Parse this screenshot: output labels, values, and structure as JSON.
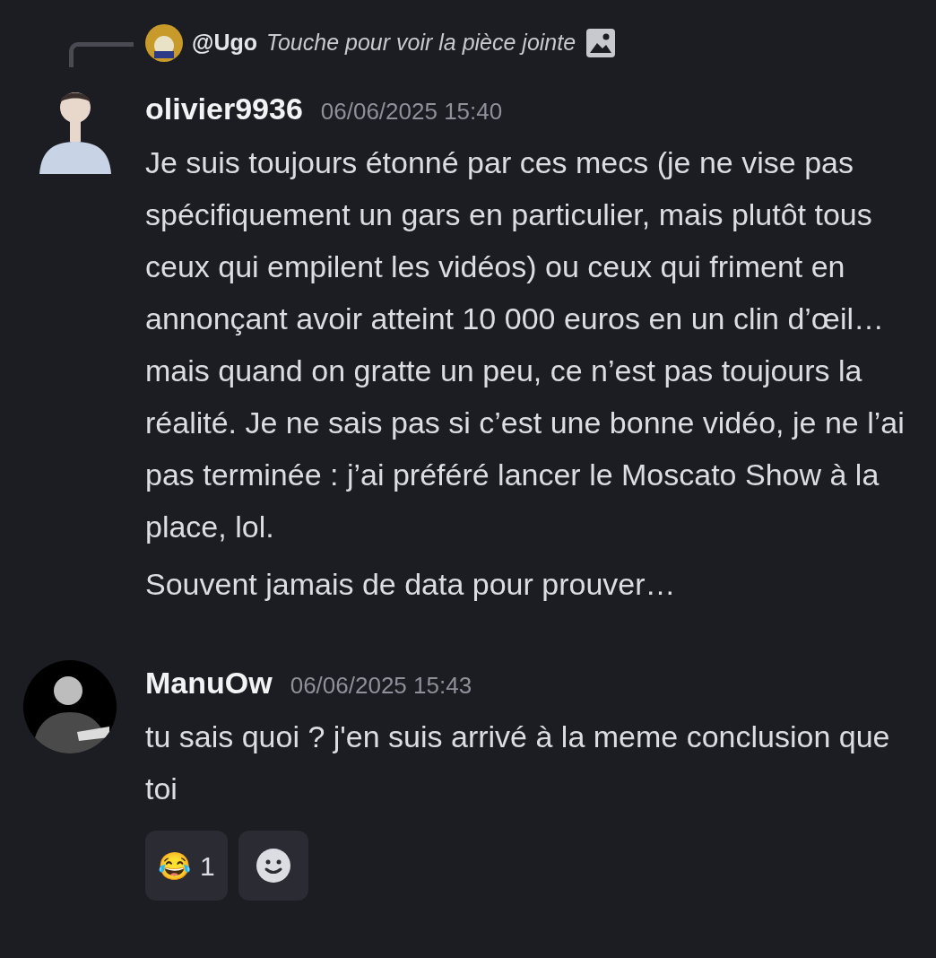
{
  "reply": {
    "author": "@Ugo",
    "preview": "Touche pour voir la pièce jointe"
  },
  "messages": [
    {
      "author": "olivier9936",
      "time": "06/06/2025 15:40",
      "paragraphs": [
        "Je suis toujours étonné par ces mecs (je ne vise pas spécifiquement un gars en particulier, mais plutôt tous ceux qui empilent les vidéos) ou ceux qui friment en annonçant avoir atteint 10 000 euros  en un clin d’œil… mais quand on gratte un peu, ce n’est pas toujours la réalité. Je ne sais pas si c’est une bonne vidéo, je ne l’ai pas terminée : j’ai préféré lancer le Moscato Show à la place, lol.",
        "Souvent jamais de data pour prouver…"
      ]
    },
    {
      "author": "ManuOw",
      "time": "06/06/2025 15:43",
      "paragraphs": [
        "tu sais quoi ? j'en suis arrivé à la meme conclusion que toi"
      ],
      "reactions": [
        {
          "emoji": "😂",
          "count": "1"
        }
      ]
    }
  ]
}
